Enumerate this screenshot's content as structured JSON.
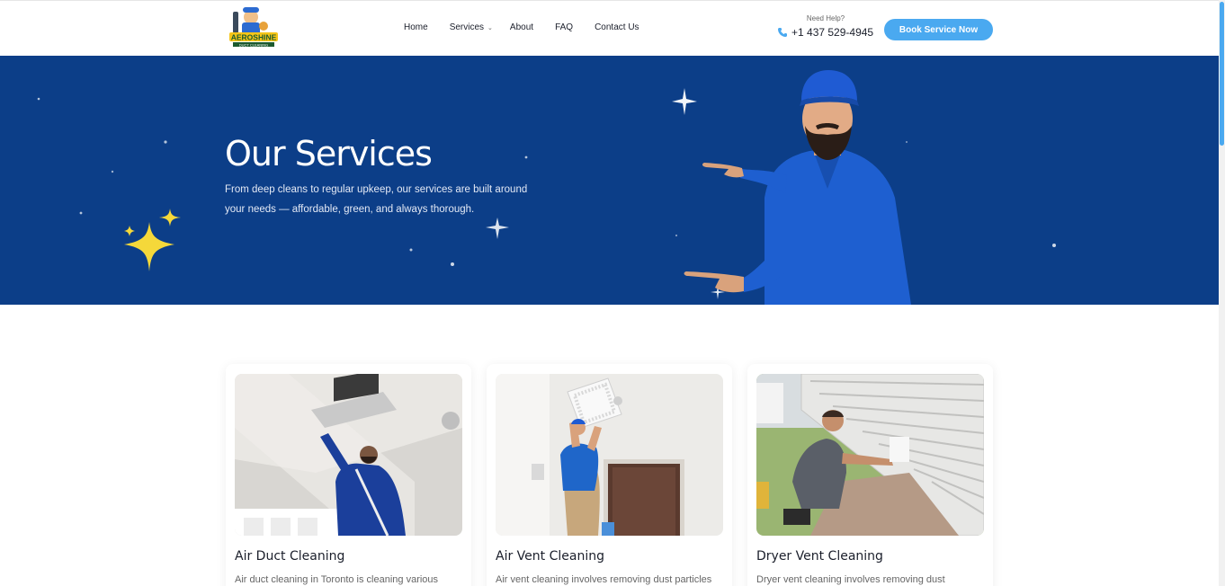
{
  "brand": {
    "logo_text": "AEROSHINE",
    "logo_sub": "DUCT CLEANING"
  },
  "nav": {
    "items": [
      {
        "label": "Home"
      },
      {
        "label": "Services"
      },
      {
        "label": "About"
      },
      {
        "label": "FAQ"
      },
      {
        "label": "Contact Us"
      }
    ]
  },
  "help": {
    "label": "Need Help?",
    "phone": "+1 437 529-4945"
  },
  "cta": {
    "label": "Book Service Now"
  },
  "hero": {
    "title": "Our Services",
    "text_line1": "From deep cleans to regular upkeep, our services are built around",
    "text_line2": "your needs — affordable, green, and always thorough."
  },
  "services": [
    {
      "title": "Air Duct Cleaning",
      "desc": "Air duct cleaning in Toronto is cleaning various"
    },
    {
      "title": "Air Vent Cleaning",
      "desc": "Air vent cleaning involves removing dust particles"
    },
    {
      "title": "Dryer Vent Cleaning",
      "desc": "Dryer vent cleaning involves removing dust"
    }
  ],
  "colors": {
    "hero_bg": "#0c3e88",
    "accent": "#4aa9f0",
    "sparkle_yellow": "#f5d83a"
  }
}
